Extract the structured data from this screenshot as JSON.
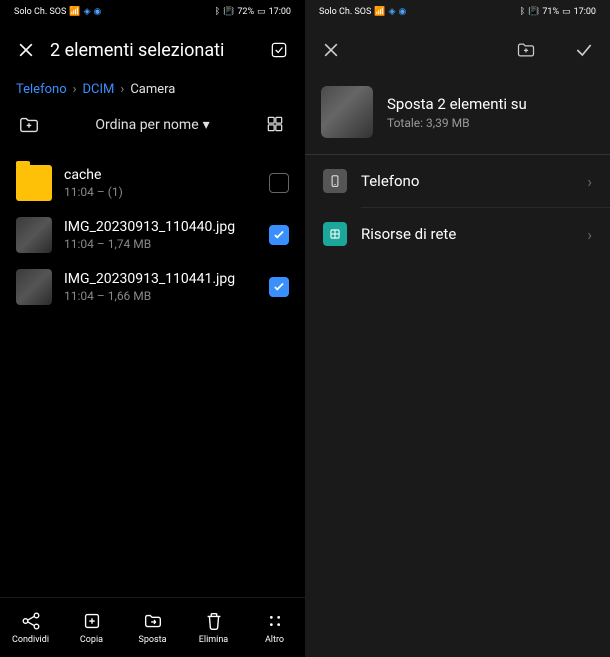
{
  "left": {
    "status": {
      "carrier": "Solo Ch. SOS",
      "battery": "72%",
      "time": "17:00"
    },
    "header": {
      "title": "2 elementi selezionati"
    },
    "breadcrumb": [
      "Telefono",
      "DCIM",
      "Camera"
    ],
    "sort": {
      "label": "Ordina per nome"
    },
    "files": [
      {
        "name": "cache",
        "meta": "11:04 – (1)",
        "type": "folder",
        "checked": false
      },
      {
        "name": "IMG_20230913_110440.jpg",
        "meta": "11:04 – 1,74 MB",
        "type": "image",
        "checked": true
      },
      {
        "name": "IMG_20230913_110441.jpg",
        "meta": "11:04 – 1,66 MB",
        "type": "image",
        "checked": true
      }
    ],
    "bottom": [
      "Condividi",
      "Copia",
      "Sposta",
      "Elimina",
      "Altro"
    ]
  },
  "right": {
    "status": {
      "carrier": "Solo Ch. SOS",
      "battery": "71%",
      "time": "17:00"
    },
    "move": {
      "title": "Sposta 2 elementi su",
      "subtitle": "Totale: 3,39 MB"
    },
    "destinations": [
      {
        "label": "Telefono",
        "icon": "phone"
      },
      {
        "label": "Risorse di rete",
        "icon": "net"
      }
    ]
  }
}
